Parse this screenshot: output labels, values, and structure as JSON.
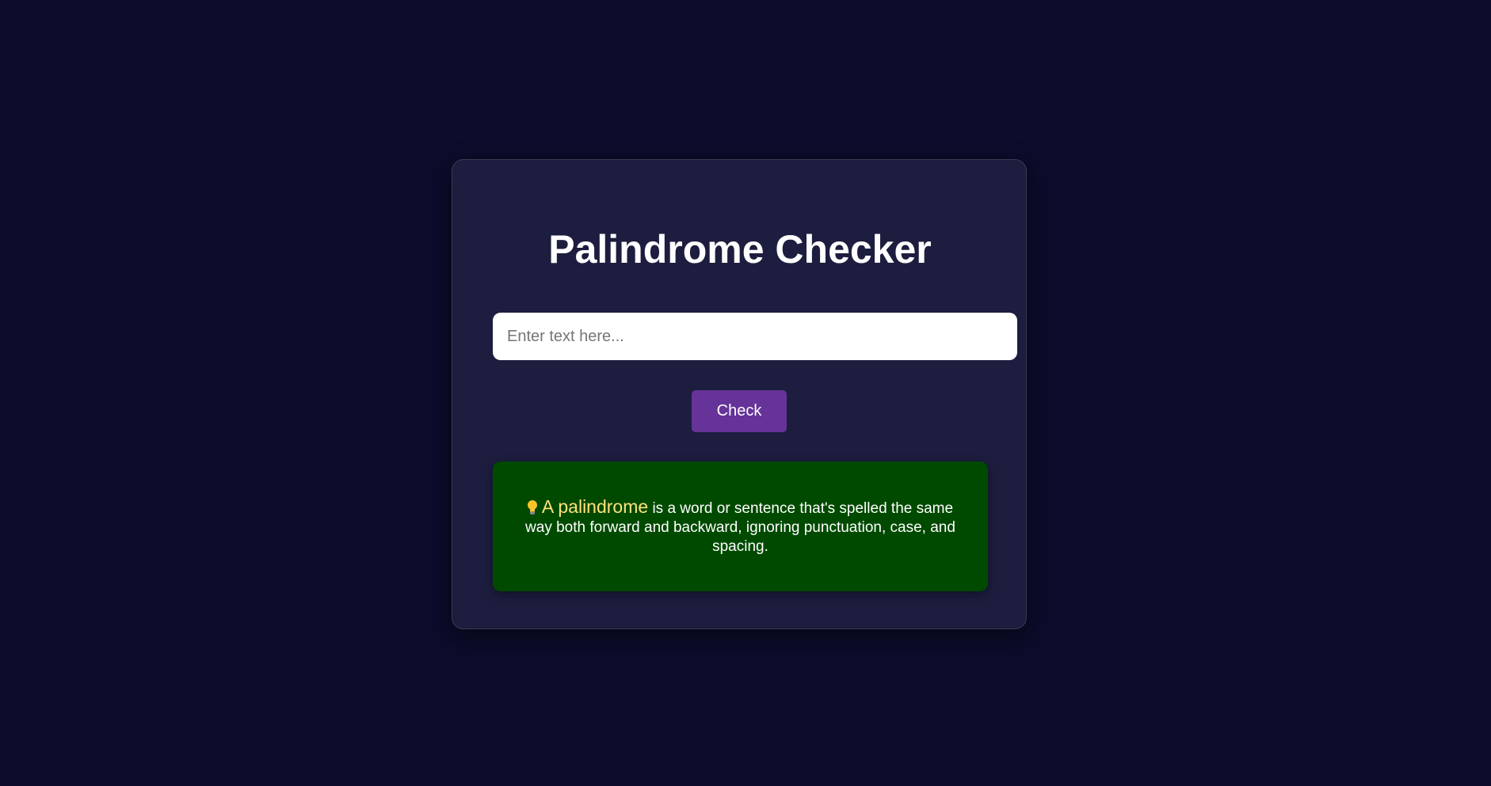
{
  "page": {
    "title": "Palindrome Checker"
  },
  "input": {
    "placeholder": "Enter text here...",
    "value": ""
  },
  "button": {
    "label": "Check"
  },
  "info": {
    "icon": "lightbulb-icon",
    "highlight": "A palindrome",
    "text": " is a word or sentence that's spelled the same way both forward and backward, ignoring punctuation, case, and spacing."
  },
  "colors": {
    "background": "#0c0c2c",
    "card": "#1d1d3f",
    "button": "#663399",
    "info_box": "#004a00",
    "highlight": "#ffe17a"
  }
}
